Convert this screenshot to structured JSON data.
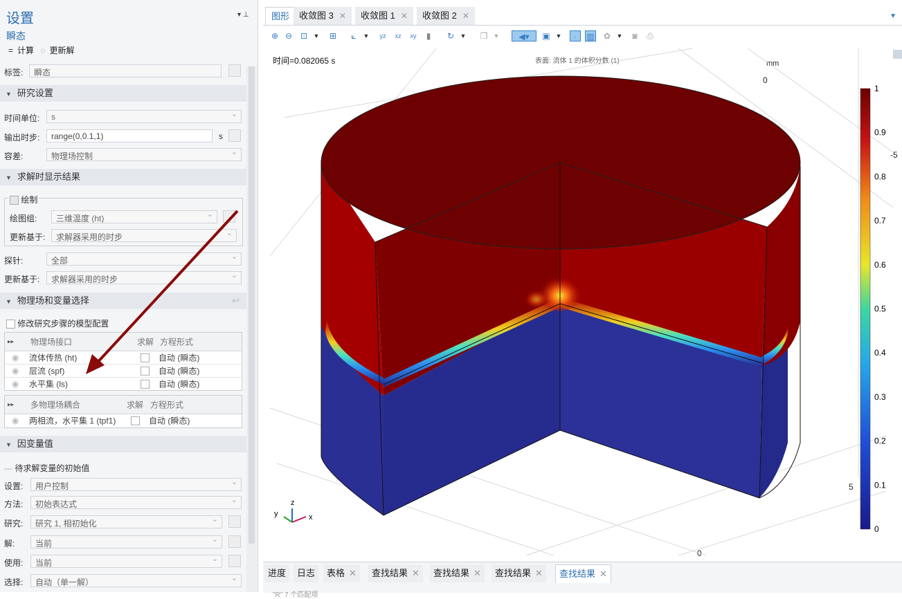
{
  "settings": {
    "title": "设置",
    "node": "瞬态",
    "compute_label": "计算",
    "update_label": "更新解",
    "tag_label": "标签:",
    "tag_value": "瞬态"
  },
  "study_settings": {
    "header": "研究设置",
    "time_unit_label": "时间单位:",
    "time_unit_value": "s",
    "output_times_label": "输出时步:",
    "output_times_value": "range(0,0.1,1)",
    "output_times_unit": "s",
    "tolerance_label": "容差:",
    "tolerance_value": "物理场控制"
  },
  "results_while_solving": {
    "header": "求解时显示结果",
    "plot_label": "绘制",
    "plot_group_label": "绘图组:",
    "plot_group_value": "三维温度 (ht)",
    "update_at_label": "更新基于:",
    "update_at_value": "求解器采用的时步",
    "probes_label": "探针:",
    "probes_value": "全部",
    "update_at2_label": "更新基于:",
    "update_at2_value": "求解器采用的时步"
  },
  "physics": {
    "header": "物理场和变量选择",
    "modify_label": "修改研究步骤的模型配置",
    "col_interface": "物理场接口",
    "col_solve": "求解",
    "col_form": "方程形式",
    "rows": [
      {
        "name": "流体传热 (ht)",
        "form": "自动 (瞬态)"
      },
      {
        "name": "层流 (spf)",
        "form": "自动 (瞬态)"
      },
      {
        "name": "水平集 (ls)",
        "form": "自动 (瞬态)"
      }
    ],
    "col_coupling": "多物理场耦合",
    "coupling_rows": [
      {
        "name": "两相流，水平集 1 (tpf1)",
        "form": "自动 (瞬态)"
      }
    ]
  },
  "dependent": {
    "header": "因变量值",
    "init_header": "待求解变量的初始值",
    "setting_label": "设置:",
    "setting_value": "用户控制",
    "method_label": "方法:",
    "method_value": "初始表达式",
    "study_label": "研究:",
    "study_value": "研究 1, 相初始化",
    "solution_label": "解:",
    "solution_value": "当前",
    "use_label": "使用:",
    "use_value": "当前",
    "selection_label": "选择:",
    "selection_value": "自动（单一解）"
  },
  "graphics": {
    "tabs": [
      "图形",
      "收敛图 3",
      "收敛图 1",
      "收敛图 2"
    ],
    "time_text": "时间=0.082065 s",
    "expr_text": "表面: 流体 1 的体积分数 (1)",
    "unit_label": "mm",
    "axis_labels": {
      "top0": "0",
      "right5": "5",
      "bottom0": "0",
      "far_minus5": "-5"
    },
    "colorbar": {
      "min": 0,
      "max": 1,
      "ticks": [
        "1",
        "0.9",
        "0.8",
        "0.7",
        "0.6",
        "0.5",
        "0.4",
        "0.3",
        "0.2",
        "0.1",
        "0"
      ]
    },
    "triad": {
      "x": "x",
      "y": "y",
      "z": "z"
    }
  },
  "bottom_tabs": [
    "进度",
    "日志",
    "表格",
    "查找结果",
    "查找结果",
    "查找结果",
    "查找结果"
  ],
  "bottom_status": "\"R\" 7 个匹配项",
  "colors": {
    "accent": "#2d6fb0",
    "liquid": "#2a2f94",
    "gas": "#8d0000"
  }
}
